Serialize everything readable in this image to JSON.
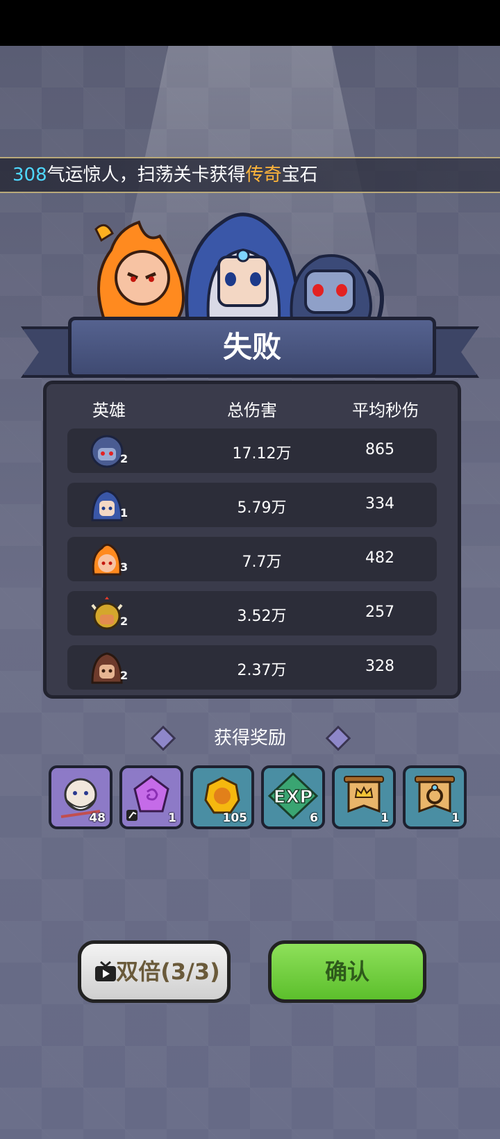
{
  "marquee": {
    "number": "308",
    "text_a": "气运惊人，扫荡关卡获得",
    "legend": "传奇",
    "text_b": "宝石"
  },
  "result": {
    "title": "失败"
  },
  "table": {
    "headers": [
      "英雄",
      "总伤害",
      "平均秒伤"
    ],
    "rows": [
      {
        "hero_icon": "dark-elf-avatar-icon",
        "level": "2",
        "damage": "17.12万",
        "dps": "865"
      },
      {
        "hero_icon": "hooded-mage-avatar-icon",
        "level": "1",
        "damage": "5.79万",
        "dps": "334"
      },
      {
        "hero_icon": "fire-spirit-avatar-icon",
        "level": "3",
        "damage": "7.7万",
        "dps": "482"
      },
      {
        "hero_icon": "horned-warrior-avatar-icon",
        "level": "2",
        "damage": "3.52万",
        "dps": "257"
      },
      {
        "hero_icon": "hooded-rogue-avatar-icon",
        "level": "2",
        "damage": "2.37万",
        "dps": "328"
      }
    ]
  },
  "rewards": {
    "title": "获得奖励",
    "items": [
      {
        "icon": "hero-shard-icon",
        "count": "48",
        "color": "#8d7ac7"
      },
      {
        "icon": "purple-gem-icon",
        "count": "1",
        "color": "#8d7ac7"
      },
      {
        "icon": "gold-coin-icon",
        "count": "105",
        "color": "#4a8ea3"
      },
      {
        "icon": "exp-icon",
        "count": "6",
        "color": "#4a8ea3"
      },
      {
        "icon": "crown-banner-icon",
        "count": "1",
        "color": "#4a8ea3"
      },
      {
        "icon": "ring-banner-icon",
        "count": "1",
        "color": "#4a8ea3"
      }
    ]
  },
  "buttons": {
    "double": "双倍(3/3)",
    "confirm": "确认"
  }
}
